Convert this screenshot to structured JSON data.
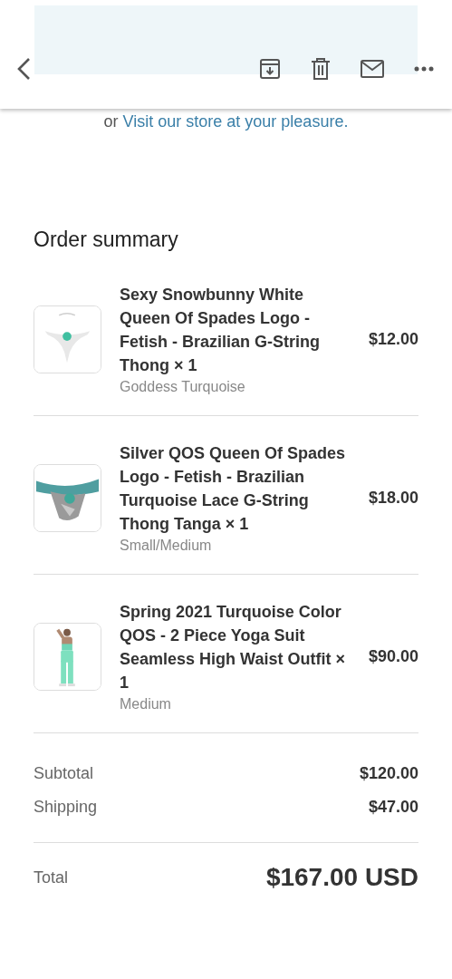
{
  "store_link": {
    "prefix": "or",
    "link": "Visit our store at your pleasure."
  },
  "order_summary": {
    "title": "Order summary",
    "items": [
      {
        "name": "Sexy Snowbunny White Queen Of Spades Logo - Fetish - Brazilian G-String Thong × 1",
        "variant": "Goddess Turquoise",
        "price": "$12.00"
      },
      {
        "name": "Silver QOS Queen Of Spades Logo - Fetish - Brazilian Turquoise Lace G-String Thong Tanga × 1",
        "variant": "Small/Medium",
        "price": "$18.00"
      },
      {
        "name": "Spring 2021 Turquoise Color QOS - 2 Piece Yoga Suit Seamless High Waist Outfit × 1",
        "variant": "Medium",
        "price": "$90.00"
      }
    ],
    "subtotals": [
      {
        "label": "Subtotal",
        "value": "$120.00"
      },
      {
        "label": "Shipping",
        "value": "$47.00"
      }
    ],
    "total": {
      "label": "Total",
      "value": "$167.00 USD"
    }
  }
}
